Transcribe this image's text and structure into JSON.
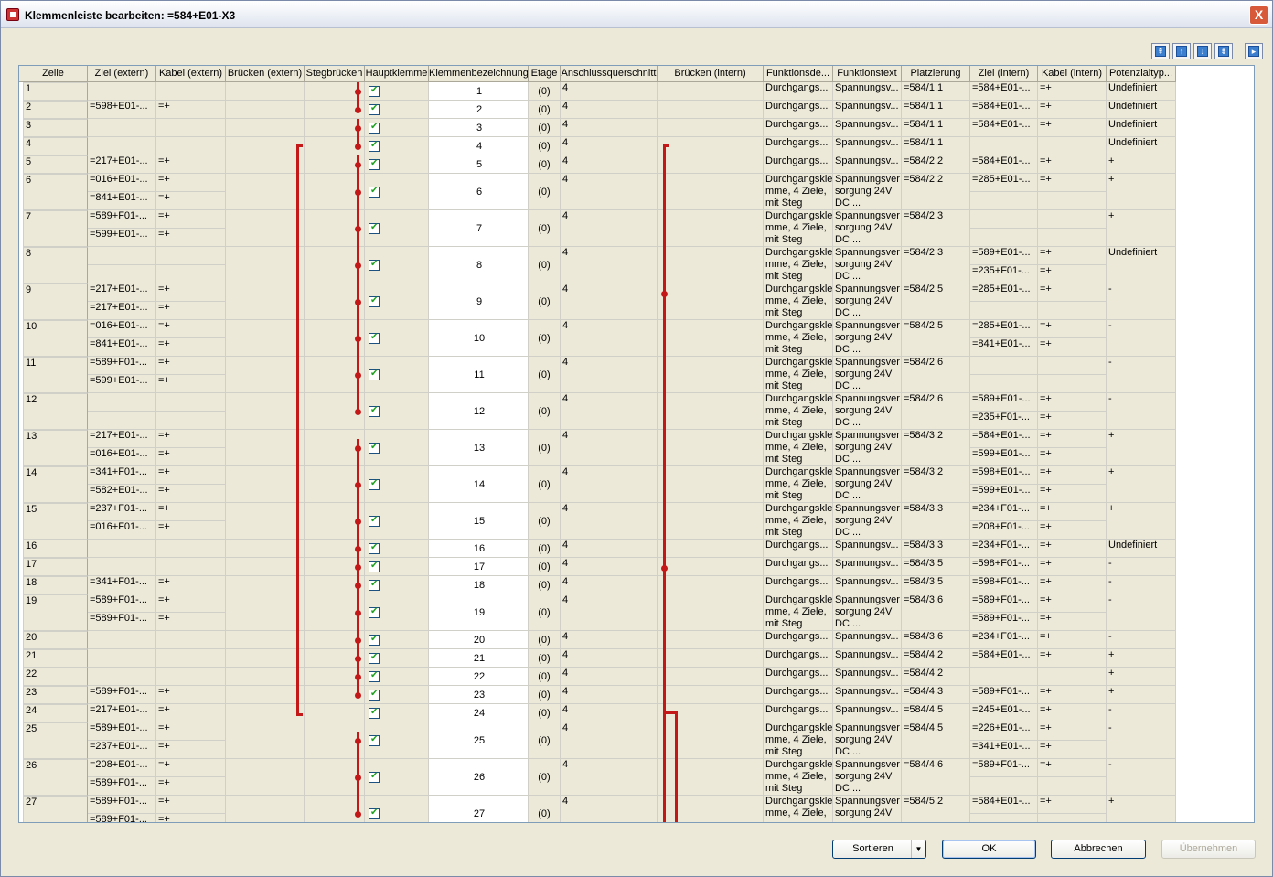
{
  "window": {
    "title": "Klemmenleiste bearbeiten: =584+E01-X3",
    "close_label": "X"
  },
  "nav": [
    "first-icon",
    "prev-icon",
    "next-icon",
    "last-icon",
    "expand-icon"
  ],
  "columns": [
    "Zeile",
    "Ziel (extern)",
    "Kabel (extern)",
    "Brücken (extern)",
    "Stegbrücken",
    "Hauptklemme",
    "Klemmenbezeichnung",
    "Etage",
    "Anschlussquerschnitt",
    "Brücken (intern)",
    "Funktionsde...",
    "Funktionstext",
    "Platzierung",
    "Ziel (intern)",
    "Kabel (intern)",
    "Potenzialtyp..."
  ],
  "rows": [
    {
      "n": "1",
      "ext": [
        ""
      ],
      "kab": [
        ""
      ],
      "kl": "1",
      "etage": "(0)",
      "q": "4",
      "fd": "Durchgangs...",
      "ft": "Spannungsv...",
      "pl": "=584/1.1",
      "zi": [
        "=584+E01-..."
      ],
      "ki": [
        "=+"
      ],
      "pot": "Undefiniert"
    },
    {
      "n": "2",
      "ext": [
        "=598+E01-..."
      ],
      "kab": [
        "=+"
      ],
      "kl": "2",
      "etage": "(0)",
      "q": "4",
      "fd": "Durchgangs...",
      "ft": "Spannungsv...",
      "pl": "=584/1.1",
      "zi": [
        "=584+E01-..."
      ],
      "ki": [
        "=+"
      ],
      "pot": "Undefiniert"
    },
    {
      "n": "3",
      "ext": [
        ""
      ],
      "kab": [
        ""
      ],
      "kl": "3",
      "etage": "(0)",
      "q": "4",
      "fd": "Durchgangs...",
      "ft": "Spannungsv...",
      "pl": "=584/1.1",
      "zi": [
        "=584+E01-..."
      ],
      "ki": [
        "=+"
      ],
      "pot": "Undefiniert"
    },
    {
      "n": "4",
      "ext": [
        ""
      ],
      "kab": [
        ""
      ],
      "kl": "4",
      "etage": "(0)",
      "q": "4",
      "fd": "Durchgangs...",
      "ft": "Spannungsv...",
      "pl": "=584/1.1",
      "zi": [
        ""
      ],
      "ki": [
        ""
      ],
      "pot": "Undefiniert"
    },
    {
      "n": "5",
      "ext": [
        "=217+E01-..."
      ],
      "kab": [
        "=+"
      ],
      "kl": "5",
      "etage": "(0)",
      "q": "4",
      "fd": "Durchgangs...",
      "ft": "Spannungsv...",
      "pl": "=584/2.2",
      "zi": [
        "=584+E01-..."
      ],
      "ki": [
        "=+"
      ],
      "pot": "+"
    },
    {
      "n": "6",
      "ext": [
        "=016+E01-...",
        "=841+E01-..."
      ],
      "kab": [
        "=+",
        "=+"
      ],
      "kl": "6",
      "etage": "(0)",
      "q": "4",
      "fd": "Durchgangskle mme, 4 Ziele, mit Steg",
      "ft": "Spannungsver sorgung 24V DC ...",
      "pl": "=584/2.2",
      "zi": [
        "=285+E01-...",
        ""
      ],
      "ki": [
        "=+",
        ""
      ],
      "pot": "+"
    },
    {
      "n": "7",
      "ext": [
        "=589+F01-...",
        "=599+E01-..."
      ],
      "kab": [
        "=+",
        "=+"
      ],
      "kl": "7",
      "etage": "(0)",
      "q": "4",
      "fd": "Durchgangskle mme, 4 Ziele, mit Steg",
      "ft": "Spannungsver sorgung 24V DC ...",
      "pl": "=584/2.3",
      "zi": [
        "",
        ""
      ],
      "ki": [
        "",
        ""
      ],
      "pot": "+"
    },
    {
      "n": "8",
      "ext": [
        "",
        ""
      ],
      "kab": [
        "",
        ""
      ],
      "kl": "8",
      "etage": "(0)",
      "q": "4",
      "fd": "Durchgangskle mme, 4 Ziele, mit Steg",
      "ft": "Spannungsver sorgung 24V DC ...",
      "pl": "=584/2.3",
      "zi": [
        "=589+E01-...",
        "=235+F01-..."
      ],
      "ki": [
        "=+",
        "=+"
      ],
      "pot": "Undefiniert"
    },
    {
      "n": "9",
      "ext": [
        "=217+E01-...",
        "=217+E01-..."
      ],
      "kab": [
        "=+",
        "=+"
      ],
      "kl": "9",
      "etage": "(0)",
      "q": "4",
      "fd": "Durchgangskle mme, 4 Ziele, mit Steg",
      "ft": "Spannungsver sorgung 24V DC ...",
      "pl": "=584/2.5",
      "zi": [
        "=285+E01-...",
        ""
      ],
      "ki": [
        "=+",
        ""
      ],
      "pot": "-"
    },
    {
      "n": "10",
      "ext": [
        "=016+E01-...",
        "=841+E01-..."
      ],
      "kab": [
        "=+",
        "=+"
      ],
      "kl": "10",
      "etage": "(0)",
      "q": "4",
      "fd": "Durchgangskle mme, 4 Ziele, mit Steg",
      "ft": "Spannungsver sorgung 24V DC ...",
      "pl": "=584/2.5",
      "zi": [
        "=285+E01-...",
        "=841+E01-..."
      ],
      "ki": [
        "=+",
        "=+"
      ],
      "pot": "-"
    },
    {
      "n": "11",
      "ext": [
        "=589+F01-...",
        "=599+E01-..."
      ],
      "kab": [
        "=+",
        "=+"
      ],
      "kl": "11",
      "etage": "(0)",
      "q": "4",
      "fd": "Durchgangskle mme, 4 Ziele, mit Steg",
      "ft": "Spannungsver sorgung 24V DC ...",
      "pl": "=584/2.6",
      "zi": [
        "",
        ""
      ],
      "ki": [
        "",
        ""
      ],
      "pot": "-"
    },
    {
      "n": "12",
      "ext": [
        "",
        ""
      ],
      "kab": [
        "",
        ""
      ],
      "kl": "12",
      "etage": "(0)",
      "q": "4",
      "fd": "Durchgangskle mme, 4 Ziele, mit Steg",
      "ft": "Spannungsver sorgung 24V DC ...",
      "pl": "=584/2.6",
      "zi": [
        "=589+E01-...",
        "=235+F01-..."
      ],
      "ki": [
        "=+",
        "=+"
      ],
      "pot": "-"
    },
    {
      "n": "13",
      "ext": [
        "=217+E01-...",
        "=016+E01-..."
      ],
      "kab": [
        "=+",
        "=+"
      ],
      "kl": "13",
      "etage": "(0)",
      "q": "4",
      "fd": "Durchgangskle mme, 4 Ziele, mit Steg",
      "ft": "Spannungsver sorgung 24V DC ...",
      "pl": "=584/3.2",
      "zi": [
        "=584+E01-...",
        "=599+E01-..."
      ],
      "ki": [
        "=+",
        "=+"
      ],
      "pot": "+"
    },
    {
      "n": "14",
      "ext": [
        "=341+F01-...",
        "=582+E01-..."
      ],
      "kab": [
        "=+",
        "=+"
      ],
      "kl": "14",
      "etage": "(0)",
      "q": "4",
      "fd": "Durchgangskle mme, 4 Ziele, mit Steg",
      "ft": "Spannungsver sorgung 24V DC ...",
      "pl": "=584/3.2",
      "zi": [
        "=598+E01-...",
        "=599+E01-..."
      ],
      "ki": [
        "=+",
        "=+"
      ],
      "pot": "+"
    },
    {
      "n": "15",
      "ext": [
        "=237+F01-...",
        "=016+F01-..."
      ],
      "kab": [
        "=+",
        "=+"
      ],
      "kl": "15",
      "etage": "(0)",
      "q": "4",
      "fd": "Durchgangskle mme, 4 Ziele, mit Steg",
      "ft": "Spannungsver sorgung 24V DC ...",
      "pl": "=584/3.3",
      "zi": [
        "=234+F01-...",
        "=208+F01-..."
      ],
      "ki": [
        "=+",
        "=+"
      ],
      "pot": "+"
    },
    {
      "n": "16",
      "ext": [
        ""
      ],
      "kab": [
        ""
      ],
      "kl": "16",
      "etage": "(0)",
      "q": "4",
      "fd": "Durchgangs...",
      "ft": "Spannungsv...",
      "pl": "=584/3.3",
      "zi": [
        "=234+F01-..."
      ],
      "ki": [
        "=+"
      ],
      "pot": "Undefiniert"
    },
    {
      "n": "17",
      "ext": [
        ""
      ],
      "kab": [
        ""
      ],
      "kl": "17",
      "etage": "(0)",
      "q": "4",
      "fd": "Durchgangs...",
      "ft": "Spannungsv...",
      "pl": "=584/3.5",
      "zi": [
        "=598+F01-..."
      ],
      "ki": [
        "=+"
      ],
      "pot": "-"
    },
    {
      "n": "18",
      "ext": [
        "=341+F01-..."
      ],
      "kab": [
        "=+"
      ],
      "kl": "18",
      "etage": "(0)",
      "q": "4",
      "fd": "Durchgangs...",
      "ft": "Spannungsv...",
      "pl": "=584/3.5",
      "zi": [
        "=598+F01-..."
      ],
      "ki": [
        "=+"
      ],
      "pot": "-"
    },
    {
      "n": "19",
      "ext": [
        "=589+F01-...",
        "=589+F01-..."
      ],
      "kab": [
        "=+",
        "=+"
      ],
      "kl": "19",
      "etage": "(0)",
      "q": "4",
      "fd": "Durchgangskle mme, 4 Ziele, mit Steg",
      "ft": "Spannungsver sorgung 24V DC ...",
      "pl": "=584/3.6",
      "zi": [
        "=589+F01-...",
        "=589+F01-..."
      ],
      "ki": [
        "=+",
        "=+"
      ],
      "pot": "-"
    },
    {
      "n": "20",
      "ext": [
        ""
      ],
      "kab": [
        ""
      ],
      "kl": "20",
      "etage": "(0)",
      "q": "4",
      "fd": "Durchgangs...",
      "ft": "Spannungsv...",
      "pl": "=584/3.6",
      "zi": [
        "=234+F01-..."
      ],
      "ki": [
        "=+"
      ],
      "pot": "-"
    },
    {
      "n": "21",
      "ext": [
        ""
      ],
      "kab": [
        ""
      ],
      "kl": "21",
      "etage": "(0)",
      "q": "4",
      "fd": "Durchgangs...",
      "ft": "Spannungsv...",
      "pl": "=584/4.2",
      "zi": [
        "=584+E01-..."
      ],
      "ki": [
        "=+"
      ],
      "pot": "+"
    },
    {
      "n": "22",
      "ext": [
        ""
      ],
      "kab": [
        ""
      ],
      "kl": "22",
      "etage": "(0)",
      "q": "4",
      "fd": "Durchgangs...",
      "ft": "Spannungsv...",
      "pl": "=584/4.2",
      "zi": [
        ""
      ],
      "ki": [
        ""
      ],
      "pot": "+"
    },
    {
      "n": "23",
      "ext": [
        "=589+F01-..."
      ],
      "kab": [
        "=+"
      ],
      "kl": "23",
      "etage": "(0)",
      "q": "4",
      "fd": "Durchgangs...",
      "ft": "Spannungsv...",
      "pl": "=584/4.3",
      "zi": [
        "=589+F01-..."
      ],
      "ki": [
        "=+"
      ],
      "pot": "+"
    },
    {
      "n": "24",
      "ext": [
        "=217+E01-..."
      ],
      "kab": [
        "=+"
      ],
      "kl": "24",
      "etage": "(0)",
      "q": "4",
      "fd": "Durchgangs...",
      "ft": "Spannungsv...",
      "pl": "=584/4.5",
      "zi": [
        "=245+E01-..."
      ],
      "ki": [
        "=+"
      ],
      "pot": "-"
    },
    {
      "n": "25",
      "ext": [
        "=589+E01-...",
        "=237+E01-..."
      ],
      "kab": [
        "=+",
        "=+"
      ],
      "kl": "25",
      "etage": "(0)",
      "q": "4",
      "fd": "Durchgangskle mme, 4 Ziele, mit Steg",
      "ft": "Spannungsver sorgung 24V DC ...",
      "pl": "=584/4.5",
      "zi": [
        "=226+E01-...",
        "=341+E01-..."
      ],
      "ki": [
        "=+",
        "=+"
      ],
      "pot": "-"
    },
    {
      "n": "26",
      "ext": [
        "=208+E01-...",
        "=589+F01-..."
      ],
      "kab": [
        "=+",
        "=+"
      ],
      "kl": "26",
      "etage": "(0)",
      "q": "4",
      "fd": "Durchgangskle mme, 4 Ziele, mit Steg",
      "ft": "Spannungsver sorgung 24V DC ...",
      "pl": "=584/4.6",
      "zi": [
        "=589+F01-...",
        ""
      ],
      "ki": [
        "=+",
        ""
      ],
      "pot": "-"
    },
    {
      "n": "27",
      "ext": [
        "=589+F01-...",
        "=589+F01-..."
      ],
      "kab": [
        "=+",
        "=+"
      ],
      "kl": "27",
      "etage": "(0)",
      "q": "4",
      "fd": "Durchgangskle mme, 4 Ziele,",
      "ft": "Spannungsver sorgung 24V",
      "pl": "=584/5.2",
      "zi": [
        "=584+E01-...",
        ""
      ],
      "ki": [
        "=+",
        ""
      ],
      "pot": "+"
    }
  ],
  "footer": {
    "sort_label": "Sortieren",
    "ok_label": "OK",
    "cancel_label": "Abbrechen",
    "apply_label": "Übernehmen"
  },
  "colors": {
    "bridge": "#c41818",
    "checkbox_check": "#21a121"
  }
}
